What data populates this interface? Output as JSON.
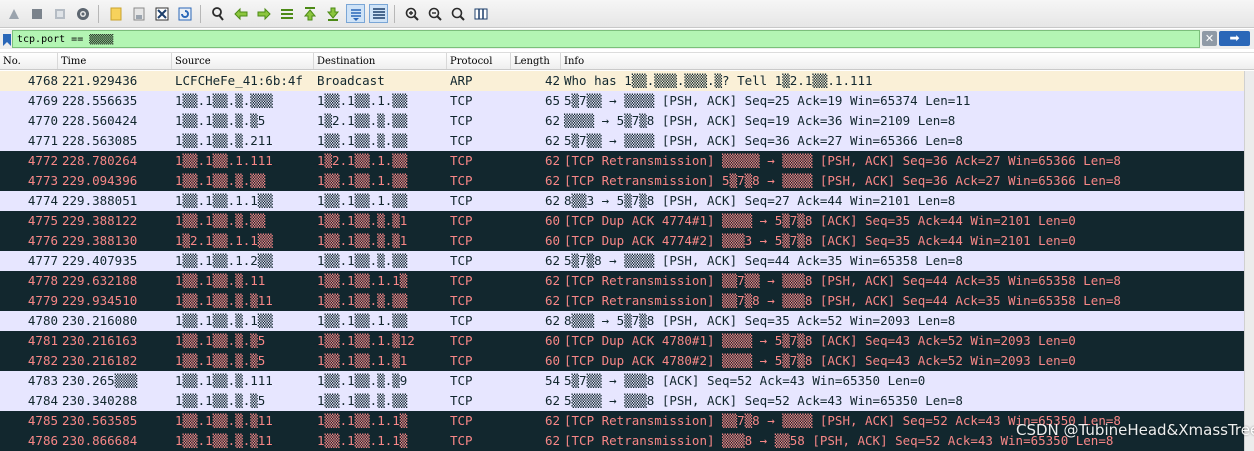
{
  "toolbar": {
    "buttons": [
      {
        "name": "start-capture-icon"
      },
      {
        "name": "stop-capture-icon"
      },
      {
        "name": "restart-capture-icon"
      },
      {
        "name": "capture-options-icon"
      },
      {
        "name": "open-file-icon"
      },
      {
        "name": "save-file-icon"
      },
      {
        "name": "close-file-icon"
      },
      {
        "name": "reload-file-icon"
      },
      {
        "name": "find-packet-icon"
      },
      {
        "name": "go-back-icon"
      },
      {
        "name": "go-forward-icon"
      },
      {
        "name": "go-to-packet-icon"
      },
      {
        "name": "go-first-packet-icon"
      },
      {
        "name": "go-last-packet-icon"
      },
      {
        "name": "auto-scroll-icon"
      },
      {
        "name": "colorize-icon"
      },
      {
        "name": "zoom-in-icon"
      },
      {
        "name": "zoom-out-icon"
      },
      {
        "name": "normal-size-icon"
      },
      {
        "name": "resize-columns-icon"
      }
    ]
  },
  "filter": {
    "value": "tcp.port == ▒▒▒▒",
    "clear_label": "✕",
    "apply_label": "➡"
  },
  "columns": [
    "No.",
    "Time",
    "Source",
    "Destination",
    "Protocol",
    "Length",
    "Info"
  ],
  "packets": [
    {
      "no": "4768",
      "time": "221.929436",
      "src": "LCFCHeFe_41:6b:4f",
      "dst": "Broadcast",
      "proto": "ARP",
      "len": "42",
      "info": "Who has 1▒▒.▒▒▒.▒▒▒.▒? Tell 1▒2.1▒▒.1.111",
      "kind": "arp"
    },
    {
      "no": "4769",
      "time": "228.556635",
      "src": "1▒▒.1▒▒.▒.▒▒▒",
      "dst": "1▒▒.1▒▒.1.▒▒",
      "proto": "TCP",
      "len": "65",
      "info": "5▒7▒▒ → ▒▒▒▒ [PSH, ACK] Seq=25 Ack=19 Win=65374 Len=11",
      "kind": "normal"
    },
    {
      "no": "4770",
      "time": "228.560424",
      "src": "1▒▒.1▒▒.▒.▒5",
      "dst": "1▒2.1▒▒.▒.▒▒",
      "proto": "TCP",
      "len": "62",
      "info": "▒▒▒▒ → 5▒7▒8 [PSH, ACK] Seq=19 Ack=36 Win=2109 Len=8",
      "kind": "normal"
    },
    {
      "no": "4771",
      "time": "228.563085",
      "src": "1▒▒.1▒▒.▒.211",
      "dst": "1▒▒.1▒▒.▒.▒▒",
      "proto": "TCP",
      "len": "62",
      "info": "5▒7▒▒ → ▒▒▒▒ [PSH, ACK] Seq=36 Ack=27 Win=65366 Len=8",
      "kind": "normal"
    },
    {
      "no": "4772",
      "time": "228.780264",
      "src": "1▒▒.1▒▒.1.111",
      "dst": "1▒2.1▒▒.1.▒▒",
      "proto": "TCP",
      "len": "62",
      "info": "[TCP Retransmission] ▒▒▒▒▒ → ▒▒▒▒ [PSH, ACK] Seq=36 Ack=27 Win=65366 Len=8",
      "kind": "bad"
    },
    {
      "no": "4773",
      "time": "229.094396",
      "src": "1▒▒.1▒▒.▒.▒▒",
      "dst": "1▒▒.1▒▒.1.▒▒",
      "proto": "TCP",
      "len": "62",
      "info": "[TCP Retransmission] 5▒7▒8 → ▒▒▒▒ [PSH, ACK] Seq=36 Ack=27 Win=65366 Len=8",
      "kind": "bad"
    },
    {
      "no": "4774",
      "time": "229.388051",
      "src": "1▒▒.1▒▒.1.1▒▒",
      "dst": "1▒▒.1▒▒.1.▒▒",
      "proto": "TCP",
      "len": "62",
      "info": "8▒▒3 → 5▒7▒8 [PSH, ACK] Seq=27 Ack=44 Win=2101 Len=8",
      "kind": "normal"
    },
    {
      "no": "4775",
      "time": "229.388122",
      "src": "1▒▒.1▒▒.▒.▒▒",
      "dst": "1▒▒.1▒▒.▒.▒1",
      "proto": "TCP",
      "len": "60",
      "info": "[TCP Dup ACK 4774#1] ▒▒▒▒ → 5▒7▒8 [ACK] Seq=35 Ack=44 Win=2101 Len=0",
      "kind": "bad"
    },
    {
      "no": "4776",
      "time": "229.388130",
      "src": "1▒2.1▒▒.1.1▒▒",
      "dst": "1▒▒.1▒▒.▒.▒1",
      "proto": "TCP",
      "len": "60",
      "info": "[TCP Dup ACK 4774#2] ▒▒▒3 → 5▒7▒8 [ACK] Seq=35 Ack=44 Win=2101 Len=0",
      "kind": "bad"
    },
    {
      "no": "4777",
      "time": "229.407935",
      "src": "1▒▒.1▒▒.1.2▒▒",
      "dst": "1▒▒.1▒▒.▒.▒▒",
      "proto": "TCP",
      "len": "62",
      "info": "5▒7▒8 → ▒▒▒▒ [PSH, ACK] Seq=44 Ack=35 Win=65358 Len=8",
      "kind": "normal"
    },
    {
      "no": "4778",
      "time": "229.632188",
      "src": "1▒▒.1▒▒.▒.11",
      "dst": "1▒▒.1▒▒.1.1▒",
      "proto": "TCP",
      "len": "62",
      "info": "[TCP Retransmission] ▒▒7▒▒ → ▒▒▒8 [PSH, ACK] Seq=44 Ack=35 Win=65358 Len=8",
      "kind": "bad"
    },
    {
      "no": "4779",
      "time": "229.934510",
      "src": "1▒▒.1▒▒.▒.▒11",
      "dst": "1▒▒.1▒▒.▒.▒▒",
      "proto": "TCP",
      "len": "62",
      "info": "[TCP Retransmission] ▒▒7▒8 → ▒▒▒8 [PSH, ACK] Seq=44 Ack=35 Win=65358 Len=8",
      "kind": "bad"
    },
    {
      "no": "4780",
      "time": "230.216080",
      "src": "1▒▒.1▒▒.▒.1▒▒",
      "dst": "1▒▒.1▒▒.1.▒▒",
      "proto": "TCP",
      "len": "62",
      "info": "8▒▒▒ → 5▒7▒8 [PSH, ACK] Seq=35 Ack=52 Win=2093 Len=8",
      "kind": "normal"
    },
    {
      "no": "4781",
      "time": "230.216163",
      "src": "1▒▒.1▒▒.▒.▒5",
      "dst": "1▒▒.1▒▒.1.▒12",
      "proto": "TCP",
      "len": "60",
      "info": "[TCP Dup ACK 4780#1] ▒▒▒▒ → 5▒7▒8 [ACK] Seq=43 Ack=52 Win=2093 Len=0",
      "kind": "bad"
    },
    {
      "no": "4782",
      "time": "230.216182",
      "src": "1▒▒.1▒▒.▒.▒5",
      "dst": "1▒▒.1▒▒.1.▒1",
      "proto": "TCP",
      "len": "60",
      "info": "[TCP Dup ACK 4780#2] ▒▒▒▒ → 5▒7▒8 [ACK] Seq=43 Ack=52 Win=2093 Len=0",
      "kind": "bad"
    },
    {
      "no": "4783",
      "time": "230.265▒▒▒",
      "src": "1▒▒.1▒▒.▒.111",
      "dst": "1▒▒.1▒▒.▒.▒9",
      "proto": "TCP",
      "len": "54",
      "info": "5▒7▒▒ → ▒▒▒8 [ACK] Seq=52 Ack=43 Win=65350 Len=0",
      "kind": "normal"
    },
    {
      "no": "4784",
      "time": "230.340288",
      "src": "1▒▒.1▒▒.▒.▒5",
      "dst": "1▒▒.1▒▒.▒.▒▒",
      "proto": "TCP",
      "len": "62",
      "info": "5▒▒▒▒ → ▒▒▒8 [PSH, ACK] Seq=52 Ack=43 Win=65350 Len=8",
      "kind": "normal"
    },
    {
      "no": "4785",
      "time": "230.563585",
      "src": "1▒▒.1▒▒.▒.▒11",
      "dst": "1▒▒.1▒▒.1.1▒",
      "proto": "TCP",
      "len": "62",
      "info": "[TCP Retransmission] ▒▒7▒8 → ▒▒▒▒ [PSH, ACK] Seq=52 Ack=43 Win=65350 Len=8",
      "kind": "bad"
    },
    {
      "no": "4786",
      "time": "230.866684",
      "src": "1▒▒.1▒▒.▒.▒11",
      "dst": "1▒▒.1▒▒.1.1▒",
      "proto": "TCP",
      "len": "62",
      "info": "[TCP Retransmission] ▒▒▒8 → ▒▒58 [PSH, ACK] Seq=52 Ack=43 Win=65350 Len=8",
      "kind": "bad"
    }
  ],
  "watermark": "CSDN @TubineHead&XmassTree",
  "colors": {
    "normal_bg": "#e7e6ff",
    "arp_bg": "#faf0d7",
    "bad_bg": "#12272e",
    "bad_fg": "#f78787",
    "filter_valid": "#b3f5b3"
  }
}
